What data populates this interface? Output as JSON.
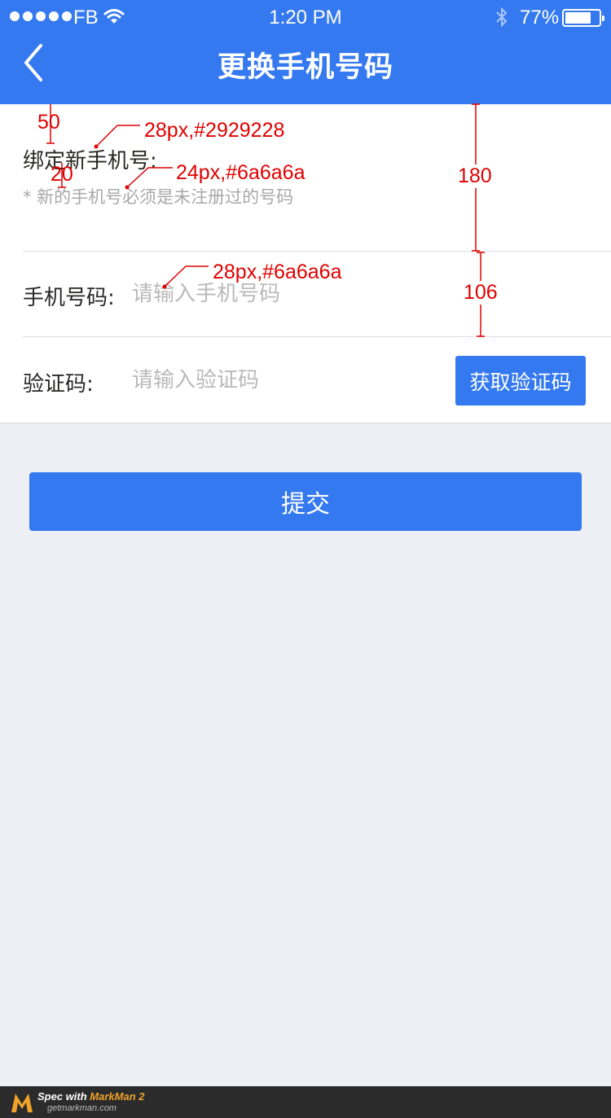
{
  "status_bar": {
    "carrier": "FB",
    "time": "1:20 PM",
    "battery": "77%",
    "battery_level": 0.77
  },
  "nav": {
    "title": "更换手机号码",
    "back_icon": "chevron-left-icon"
  },
  "bind_section": {
    "label": "绑定新手机号:",
    "hint": "* 新的手机号必须是未注册过的号码"
  },
  "phone_row": {
    "label": "手机号码:",
    "placeholder": "请输入手机号码",
    "value": ""
  },
  "code_row": {
    "label": "验证码:",
    "placeholder": "请输入验证码",
    "value": "",
    "button_label": "获取验证码"
  },
  "submit_label": "提交",
  "annotations": {
    "title_spec": "28px,#2929228",
    "hint_spec": "24px,#6a6a6a",
    "input_spec": "28px,#6a6a6a",
    "top_gap": "50",
    "label_gap": "20",
    "section_height": "180",
    "row_height": "106"
  },
  "footer": {
    "brand_prefix": "Spec with ",
    "brand_name": "MarkMan 2",
    "url": "getmarkman.com"
  },
  "colors": {
    "primary": "#3479ef",
    "background": "#eeeff4",
    "annotation": "#e00000"
  }
}
